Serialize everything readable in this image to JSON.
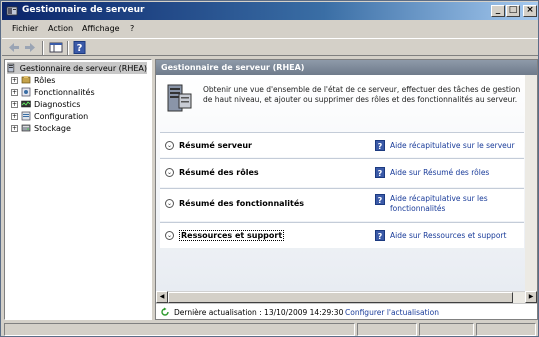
{
  "window": {
    "title": "Gestionnaire de serveur",
    "controls": {
      "minimize": "_",
      "maximize": "□",
      "close": "×"
    }
  },
  "menu": [
    "Fichier",
    "Action",
    "Affichage",
    "?"
  ],
  "toolbar": {
    "icons": [
      "back-arrow-icon",
      "forward-arrow-icon",
      "show-hide-console-tree-icon",
      "help-icon"
    ]
  },
  "tree": {
    "root": "Gestionnaire de serveur (RHEA)",
    "items": [
      {
        "label": "Rôles",
        "icon": "roles-icon"
      },
      {
        "label": "Fonctionnalités",
        "icon": "features-icon"
      },
      {
        "label": "Diagnostics",
        "icon": "diagnostics-icon"
      },
      {
        "label": "Configuration",
        "icon": "configuration-icon"
      },
      {
        "label": "Stockage",
        "icon": "storage-icon"
      }
    ]
  },
  "content": {
    "header": "Gestionnaire de serveur (RHEA)",
    "intro": "Obtenir une vue d'ensemble de l'état de ce serveur, effectuer des tâches de gestion de haut niveau, et ajouter ou supprimer des rôles et des fonctionnalités au serveur.",
    "sections": [
      {
        "title": "Résumé serveur",
        "help": "Aide récapitulative sur le serveur"
      },
      {
        "title": "Résumé des rôles",
        "help": "Aide sur Résumé des rôles"
      },
      {
        "title": "Résumé des fonctionnalités",
        "help": "Aide récapitulative sur les fonctionnalités"
      },
      {
        "title": "Ressources et support",
        "help": "Aide sur Ressources et support"
      }
    ],
    "last_refresh": "Dernière actualisation : 13/10/2009 14:29:30",
    "configure_refresh": "Configurer l'actualisation"
  },
  "colors": {
    "title_bar_start": "#0a246a",
    "header_bar": "#7d8898",
    "link": "#1a3c9a"
  }
}
